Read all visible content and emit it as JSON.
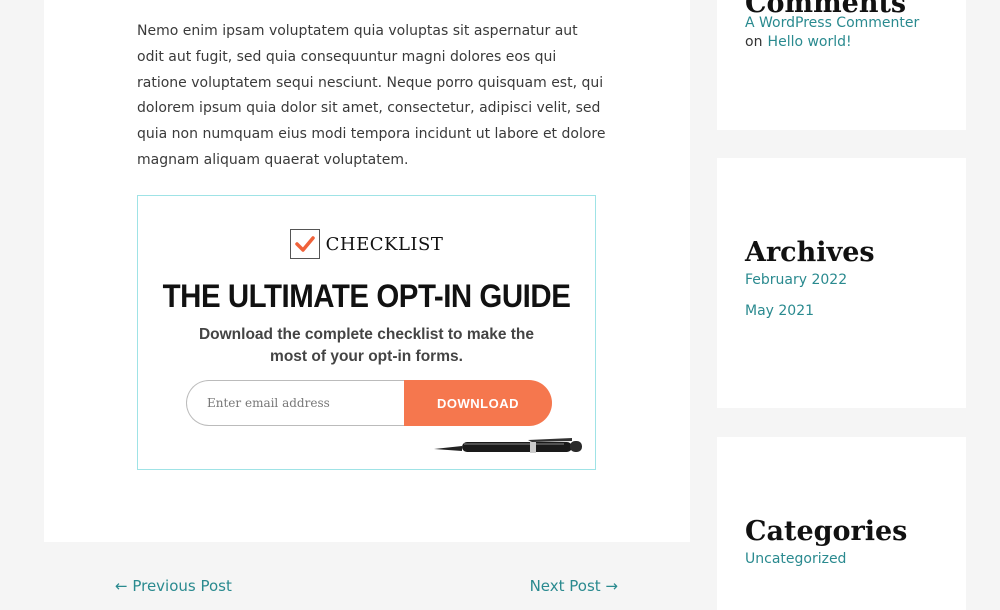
{
  "post": {
    "paragraph": "Nemo enim ipsam voluptatem quia voluptas sit aspernatur aut odit aut fugit, sed quia consequuntur magni dolores eos qui ratione voluptatem sequi nesciunt. Neque porro quisquam est, qui dolorem ipsum quia dolor sit amet, consectetur, adipisci velit, sed quia non numquam eius modi tempora incidunt ut labore et dolore magnam aliquam quaerat voluptatem."
  },
  "optin": {
    "checklist_label": "CHECKLIST",
    "title": "THE ULTIMATE OPT-IN GUIDE",
    "subtitle": "Download the complete checklist to make the most of your opt-in forms.",
    "email_placeholder": "Enter email address",
    "button_label": "DOWNLOAD",
    "accent_color": "#f5774e"
  },
  "post_nav": {
    "previous": "← Previous Post",
    "next": "Next Post →"
  },
  "sidebar": {
    "comments": {
      "title": "Comments",
      "author": "A WordPress Commenter",
      "on_text": "on",
      "post": "Hello world!"
    },
    "archives": {
      "title": "Archives",
      "items": [
        "February 2022",
        "May 2021"
      ]
    },
    "categories": {
      "title": "Categories",
      "items": [
        "Uncategorized"
      ]
    }
  },
  "colors": {
    "link": "#2a8a8f",
    "background": "#f5f5f5",
    "card": "#ffffff"
  }
}
